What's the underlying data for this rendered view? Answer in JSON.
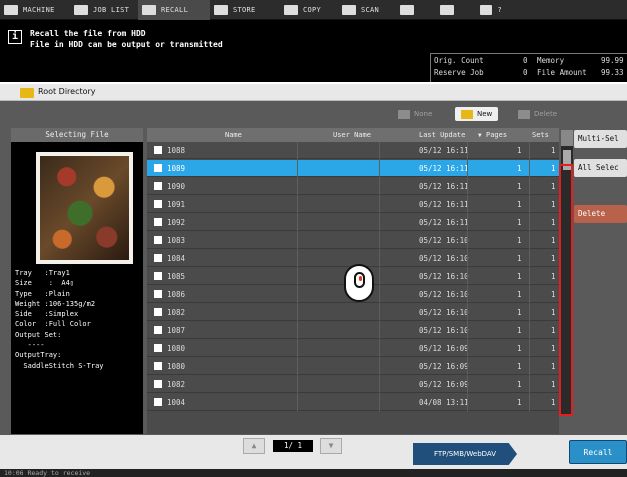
{
  "topbar": {
    "tabs": [
      {
        "label": "MACHINE",
        "icon": "machine-icon"
      },
      {
        "label": "JOB LIST",
        "icon": "job-list-icon"
      },
      {
        "label": "RECALL",
        "icon": "recall-icon"
      },
      {
        "label": "STORE",
        "icon": "store-icon"
      },
      {
        "label": "COPY",
        "icon": "copy-icon"
      },
      {
        "label": "SCAN",
        "icon": "scan-icon"
      },
      {
        "label": "",
        "icon": "network-icon"
      },
      {
        "label": "",
        "icon": "speaker-icon"
      },
      {
        "label": "?",
        "icon": "help-icon"
      }
    ]
  },
  "message": {
    "line1": "Recall the file from HDD",
    "line2": "File in HDD can be output or transmitted",
    "icon": "info-icon"
  },
  "counters": {
    "orig_count_label": "Orig. Count",
    "orig_count_value": "0",
    "memory_label": "Memory",
    "memory_value": "99.99",
    "reserve_job_label": "Reserve Job",
    "reserve_job_value": "0",
    "file_amount_label": "File Amount",
    "file_amount_value": "99.33"
  },
  "directory": {
    "label": "Root Directory",
    "icon": "folder-icon"
  },
  "toolbar": {
    "none_label": "None",
    "new_label": "New",
    "delete_label": "Delete"
  },
  "left_panel": {
    "header": "Selecting File",
    "props": "Tray   :Tray1\nSize    :  A4▯\nType   :Plain\nWeight :106-135g/m2\nSide   :Simplex\nColor  :Full Color\nOutput Set:\n   ----\nOutputTray:\n  SaddleStitch S-Tray"
  },
  "table": {
    "headers": {
      "name": "Name",
      "user": "User Name",
      "updated": "Last Update",
      "sort_icon": "▼",
      "pages": "Pages",
      "sets": "Sets"
    },
    "rows": [
      {
        "name": "1088",
        "updated": "05/12 16:11",
        "pages": "1",
        "sets": "1",
        "selected": false
      },
      {
        "name": "1089",
        "updated": "05/12 16:11",
        "pages": "1",
        "sets": "1",
        "selected": true
      },
      {
        "name": "1090",
        "updated": "05/12 16:11",
        "pages": "1",
        "sets": "1",
        "selected": false
      },
      {
        "name": "1091",
        "updated": "05/12 16:11",
        "pages": "1",
        "sets": "1",
        "selected": false
      },
      {
        "name": "1092",
        "updated": "05/12 16:11",
        "pages": "1",
        "sets": "1",
        "selected": false
      },
      {
        "name": "1083",
        "updated": "05/12 16:10",
        "pages": "1",
        "sets": "1",
        "selected": false
      },
      {
        "name": "1084",
        "updated": "05/12 16:10",
        "pages": "1",
        "sets": "1",
        "selected": false
      },
      {
        "name": "1085",
        "updated": "05/12 16:10",
        "pages": "1",
        "sets": "1",
        "selected": false
      },
      {
        "name": "1086",
        "updated": "05/12 16:10",
        "pages": "1",
        "sets": "1",
        "selected": false
      },
      {
        "name": "1082",
        "updated": "05/12 16:10",
        "pages": "1",
        "sets": "1",
        "selected": false
      },
      {
        "name": "1087",
        "updated": "05/12 16:10",
        "pages": "1",
        "sets": "1",
        "selected": false
      },
      {
        "name": "1080",
        "updated": "05/12 16:09",
        "pages": "1",
        "sets": "1",
        "selected": false
      },
      {
        "name": "1080",
        "updated": "05/12 16:09",
        "pages": "1",
        "sets": "1",
        "selected": false
      },
      {
        "name": "1082",
        "updated": "05/12 16:09",
        "pages": "1",
        "sets": "1",
        "selected": false
      },
      {
        "name": "1004",
        "updated": "04/08 13:11",
        "pages": "1",
        "sets": "1",
        "selected": false
      }
    ]
  },
  "side_buttons": {
    "multi": "Multi-Sel",
    "all": "All Selec",
    "delete": "Delete"
  },
  "pager": {
    "prev": "▲",
    "current": "1/ 1",
    "next": "▼"
  },
  "bottom": {
    "ftp_label": "FTP/SMB/WebDAV",
    "recall_label": "Recall"
  },
  "status": {
    "text": "10:06  Ready to receive"
  },
  "colors": {
    "accent": "#2ba6e6",
    "highlight": "#e41d1d",
    "folder": "#e7b718"
  }
}
